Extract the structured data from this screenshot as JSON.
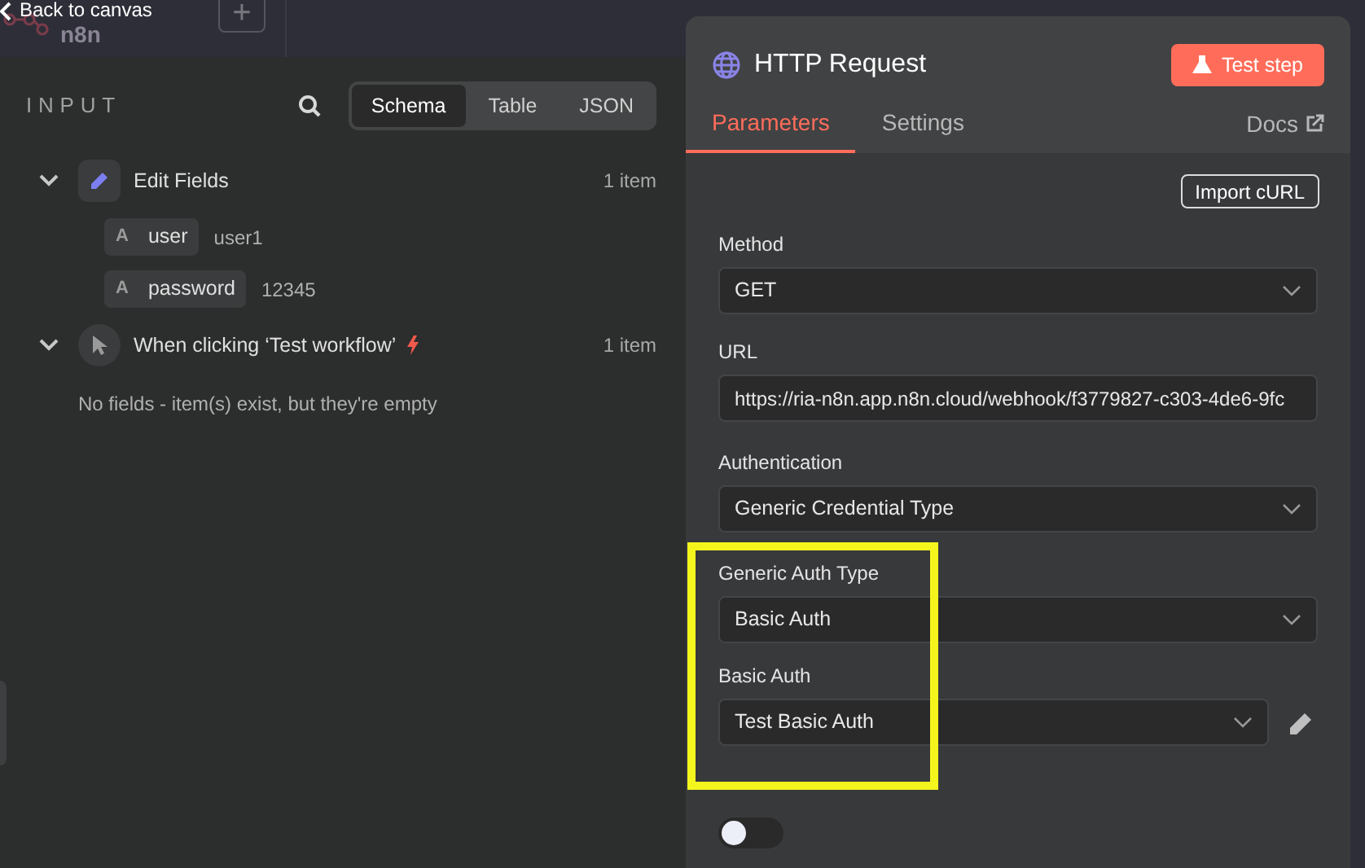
{
  "top_bar": {
    "back_link": "Back to canvas",
    "logo_text": "n8n",
    "add_button": "+"
  },
  "input_panel": {
    "title": "INPUT",
    "view_tabs": [
      {
        "label": "Schema",
        "selected": true
      },
      {
        "label": "Table",
        "selected": false
      },
      {
        "label": "JSON",
        "selected": false
      }
    ],
    "nodes": [
      {
        "name": "Edit Fields",
        "kind": "edit",
        "count": "1 item",
        "expanded": true,
        "fields": [
          {
            "type": "A",
            "key": "user",
            "value": "user1"
          },
          {
            "type": "A",
            "key": "password",
            "value": "12345"
          }
        ]
      },
      {
        "name": "When clicking ‘Test workflow’",
        "kind": "trigger",
        "count": "1 item",
        "expanded": true,
        "empty_message": "No fields - item(s) exist, but they're empty"
      }
    ]
  },
  "node_panel": {
    "title": "HTTP Request",
    "test_button": "Test step",
    "tabs": [
      {
        "label": "Parameters",
        "selected": true
      },
      {
        "label": "Settings",
        "selected": false
      }
    ],
    "docs_link": "Docs",
    "import_button": "Import cURL",
    "params": [
      {
        "label": "Method",
        "kind": "select",
        "value": "GET"
      },
      {
        "label": "URL",
        "kind": "text",
        "value": "https://ria-n8n.app.n8n.cloud/webhook/f3779827-c303-4de6-9fc"
      },
      {
        "label": "Authentication",
        "kind": "select",
        "value": "Generic Credential Type"
      },
      {
        "label": "Generic Auth Type",
        "kind": "select",
        "value": "Basic Auth"
      },
      {
        "label": "Basic Auth",
        "kind": "credential",
        "value": "Test Basic Auth"
      },
      {
        "kind": "toggle",
        "on": false
      }
    ]
  }
}
